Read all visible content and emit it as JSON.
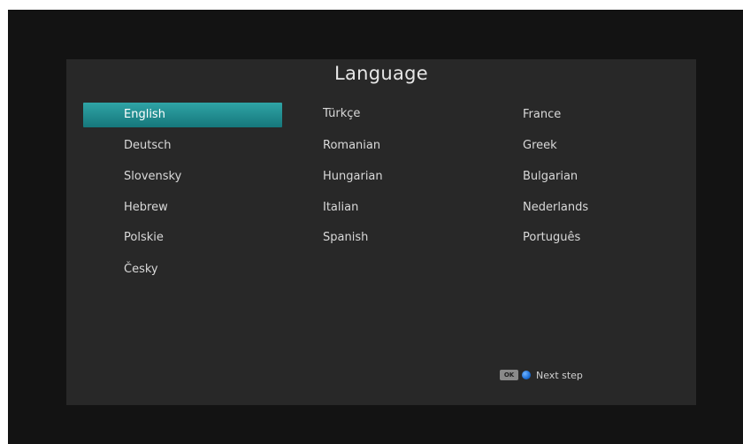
{
  "title": "Language",
  "selected": "English",
  "columns": [
    [
      "English",
      "Deutsch",
      "Slovensky",
      "Hebrew",
      "Polskie",
      "Česky"
    ],
    [
      "Türkçe",
      "Romanian",
      "Hungarian",
      "Italian",
      "Spanish"
    ],
    [
      "France",
      "Greek",
      "Bulgarian",
      "Nederlands",
      "Português"
    ]
  ],
  "hint": {
    "ok_key": "OK",
    "label": "Next step",
    "icon": "blue-circle-icon"
  },
  "colors": {
    "selection": "#1f8f93",
    "panel": "#282828",
    "background": "#131313"
  }
}
